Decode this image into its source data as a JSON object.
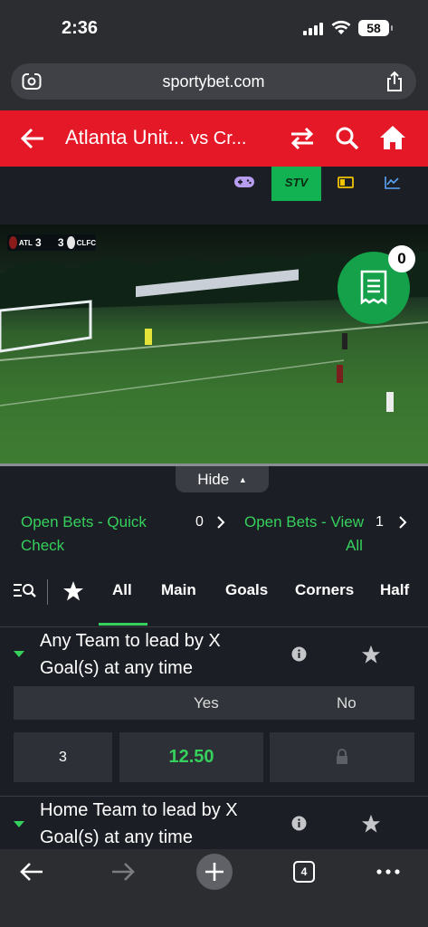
{
  "status_bar": {
    "time": "2:36",
    "battery": "58"
  },
  "browser": {
    "url": "sportybet.com"
  },
  "header": {
    "home_team": "Atlanta Unit...",
    "vs_label": "vs Cr..."
  },
  "toolbar": {
    "stv_label": "STV"
  },
  "video": {
    "home_abbr": "ATL",
    "away_abbr": "CLFC",
    "home_score": "3",
    "away_score": "3"
  },
  "betslip": {
    "count": "0"
  },
  "hide_label": "Hide",
  "open_bets": {
    "quick_check": {
      "line1": "Open Bets - Quick",
      "line2": "Check",
      "count": "0"
    },
    "view_all": {
      "line1": "Open Bets - View",
      "line2": "All",
      "count": "1"
    }
  },
  "market_tabs": [
    "All",
    "Main",
    "Goals",
    "Corners",
    "Half"
  ],
  "markets": [
    {
      "title_line1": "Any Team to lead by X",
      "title_line2": "Goal(s) at any time",
      "col_yes": "Yes",
      "col_no": "No",
      "line": "3",
      "odds_yes": "12.50"
    },
    {
      "title_line1": "Home Team to lead by X",
      "title_line2": "Goal(s) at any time"
    }
  ],
  "bottom_bar": {
    "tabs_count": "4"
  },
  "colors": {
    "brand_red": "#e41827",
    "accent_green": "#36d05c",
    "betslip_green": "#14a149",
    "stv_green": "#12b152"
  }
}
